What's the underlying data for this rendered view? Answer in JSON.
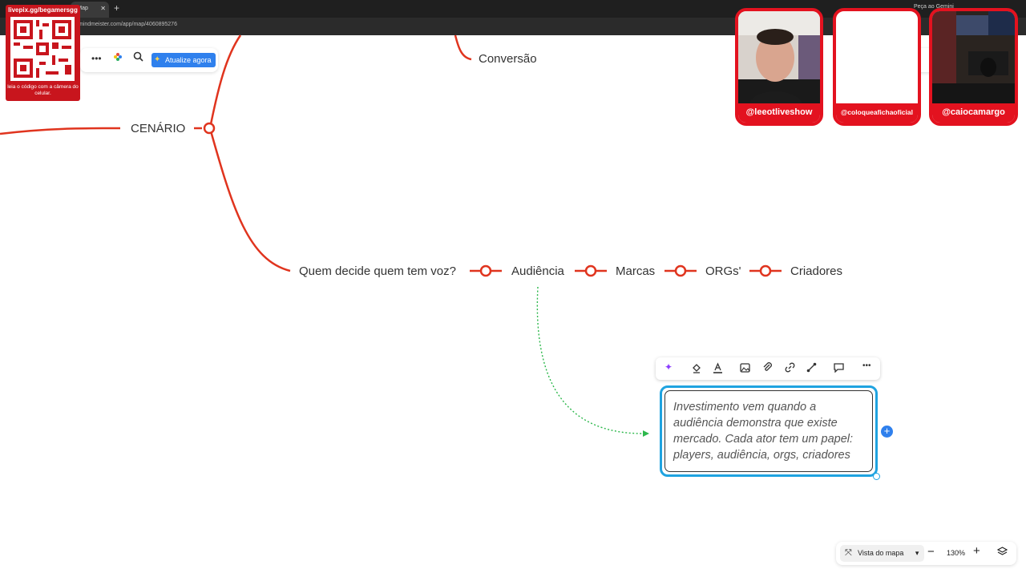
{
  "browser": {
    "tab_title": "r Map",
    "url": "mindmeister.com/app/map/4060895276",
    "tab_right_label": "Peça ao Gemini"
  },
  "map": {
    "nodes": {
      "conversao": "Conversão",
      "cenario": "CENÁRIO",
      "quem_decide": "Quem decide quem tem voz?",
      "audiencia": "Audiência",
      "marcas": "Marcas",
      "orgs": "ORGs'",
      "criadores": "Criadores"
    },
    "selected_note": "Investimento vem quando a audiência demonstra que existe mercado. Cada ator tem um papel: players, audiência, orgs, criadores",
    "branch_color": "#e0341e",
    "connector_color": "#2db84c",
    "selection_color": "#1fa3e0"
  },
  "toolbar_left": {
    "update_label": "Atualize agora"
  },
  "overlay": {
    "qr_title": "livepix.gg/begamersgg",
    "qr_caption": "leia o código com a câmera do celular."
  },
  "webcams": [
    {
      "handle": "@leeotliveshow"
    },
    {
      "handle": "@coloqueafichaoficial"
    },
    {
      "handle": "@caiocamargo"
    }
  ],
  "bottom_bar": {
    "view_label": "Vista do mapa",
    "zoom": "130%"
  },
  "icons": {
    "more": "more-icon",
    "palette": "palette-icon",
    "search": "search-icon",
    "ai": "ai-sparkle-icon",
    "plus": "plus-icon"
  }
}
